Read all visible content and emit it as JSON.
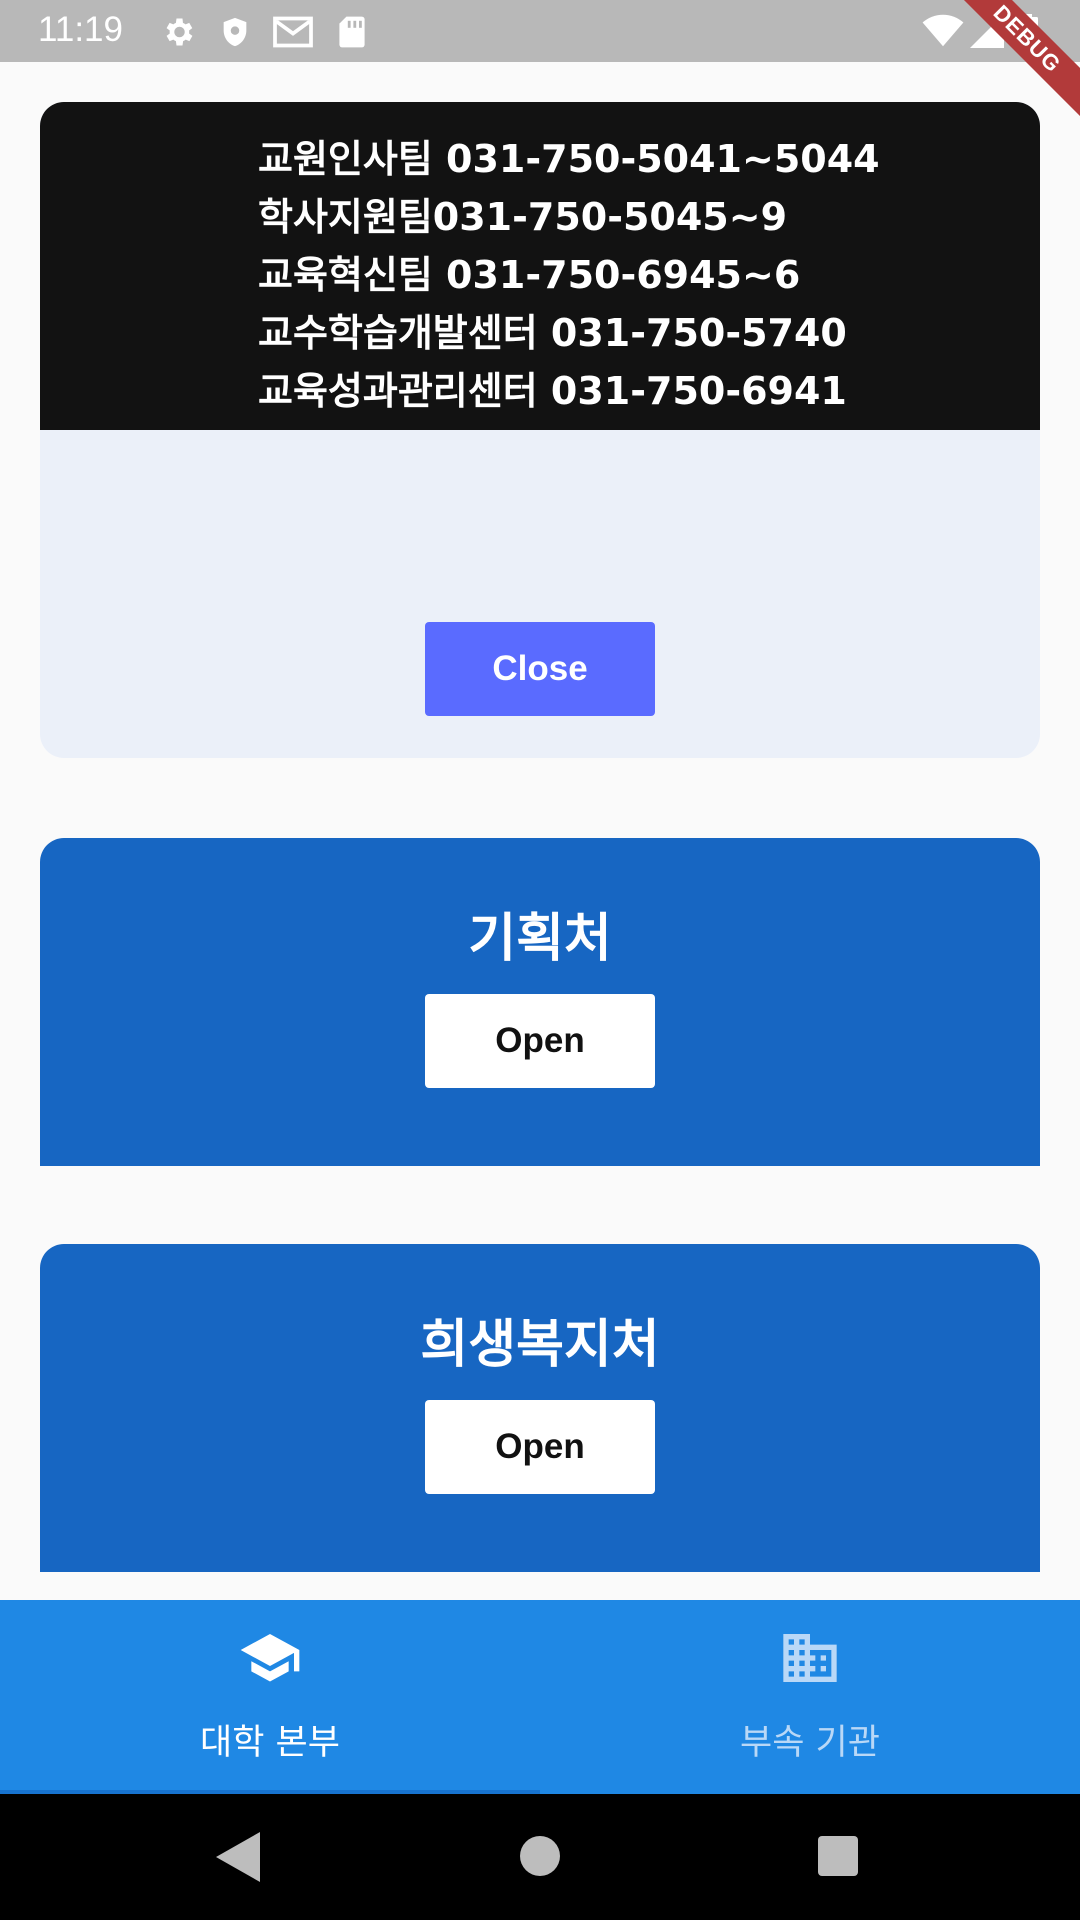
{
  "status_bar": {
    "time": "11:19",
    "icons": [
      "gear-icon",
      "shield-icon",
      "gmail-icon",
      "sd-card-icon",
      "wifi-icon",
      "signal-icon",
      "battery-icon"
    ],
    "debug_label": "DEBUG"
  },
  "expanded_card": {
    "contact_lines": [
      "교원인사팀 031-750-5041~5044",
      "학사지원팀031-750-5045~9",
      "교육혁신팀 031-750-6945~6",
      "교수학습개발센터 031-750-5740",
      "교육성과관리센터 031-750-6941"
    ],
    "close_label": "Close"
  },
  "departments": [
    {
      "title": "기획처",
      "open_label": "Open"
    },
    {
      "title": "희생복지처",
      "open_label": "Open"
    }
  ],
  "bottom_nav": {
    "items": [
      {
        "label": "대학 본부",
        "icon": "graduation-cap-icon",
        "selected": true
      },
      {
        "label": "부속 기관",
        "icon": "building-icon",
        "selected": false
      }
    ]
  },
  "colors": {
    "card_blue": "#1766c2",
    "nav_blue": "#1f88e4",
    "close_button": "#5a6bff",
    "contact_panel": "#121212"
  }
}
